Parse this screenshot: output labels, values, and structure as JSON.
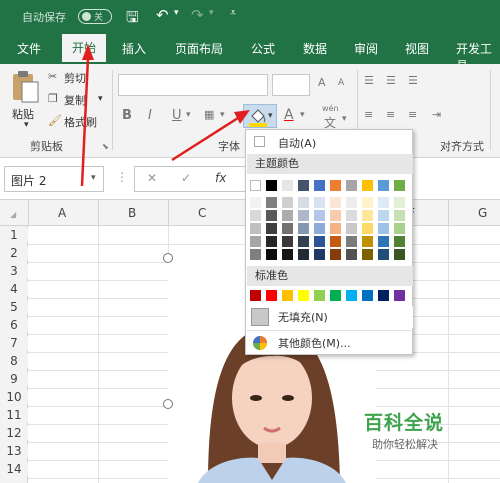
{
  "titlebar": {
    "autosave_label": "自动保存",
    "toggle_state": "关"
  },
  "tabs": [
    "文件",
    "开始",
    "插入",
    "页面布局",
    "公式",
    "数据",
    "审阅",
    "视图",
    "开发工具"
  ],
  "active_tab": "开始",
  "ribbon": {
    "clipboard": {
      "paste": "粘贴",
      "cut": "剪切",
      "copy": "复制",
      "format_painter": "格式刷",
      "group": "剪贴板"
    },
    "font_group": "字体",
    "align_group": "对齐方式",
    "bold": "B",
    "italic": "I",
    "underline": "U",
    "font_color_letter": "A",
    "phonetic": "wén"
  },
  "formula": {
    "namebox": "图片 2",
    "cancel": "✕",
    "enter": "✓",
    "fx": "fx"
  },
  "columns": [
    "A",
    "B",
    "C",
    "F",
    "G"
  ],
  "rows": [
    "1",
    "2",
    "3",
    "4",
    "5",
    "6",
    "7",
    "8",
    "9",
    "10",
    "11",
    "12",
    "13",
    "14"
  ],
  "dropdown": {
    "auto": "自动(A)",
    "theme_header": "主题颜色",
    "standard_header": "标准色",
    "no_fill": "无填充(N)",
    "more_colors": "其他颜色(M)..."
  },
  "colors": {
    "accent": "#217346",
    "theme_top": [
      "#ffffff",
      "#000000",
      "#e7e6e6",
      "#44546a",
      "#4472c4",
      "#ed7d31",
      "#a5a5a5",
      "#ffc000",
      "#5b9bd5",
      "#70ad47"
    ],
    "theme_shades": [
      [
        "#f2f2f2",
        "#d8d8d8",
        "#bfbfbf",
        "#a5a5a5",
        "#7f7f7f"
      ],
      [
        "#7f7f7f",
        "#595959",
        "#3f3f3f",
        "#262626",
        "#0c0c0c"
      ],
      [
        "#d0cece",
        "#aeabab",
        "#757171",
        "#3a3838",
        "#171616"
      ],
      [
        "#d6dce5",
        "#adb9ca",
        "#8497b0",
        "#333f50",
        "#222a35"
      ],
      [
        "#d9e2f3",
        "#b4c6e7",
        "#8eaadb",
        "#2f5496",
        "#1f3864"
      ],
      [
        "#fbe5d6",
        "#f8cbad",
        "#f4b183",
        "#c55a11",
        "#843c0c"
      ],
      [
        "#ededed",
        "#dbdbdb",
        "#c9c9c9",
        "#7b7b7b",
        "#525252"
      ],
      [
        "#fff2cc",
        "#ffe699",
        "#ffd966",
        "#bf9000",
        "#7f6000"
      ],
      [
        "#deebf7",
        "#bdd7ee",
        "#9dc3e6",
        "#2e75b6",
        "#1f4e79"
      ],
      [
        "#e2f0d9",
        "#c5e0b4",
        "#a9d18e",
        "#548235",
        "#385723"
      ]
    ],
    "standard": [
      "#c00000",
      "#ff0000",
      "#ffc000",
      "#ffff00",
      "#92d050",
      "#00b050",
      "#00b0f0",
      "#0070c0",
      "#002060",
      "#7030a0"
    ]
  },
  "watermark": {
    "title": "百科全说",
    "subtitle": "助你轻松解决"
  }
}
